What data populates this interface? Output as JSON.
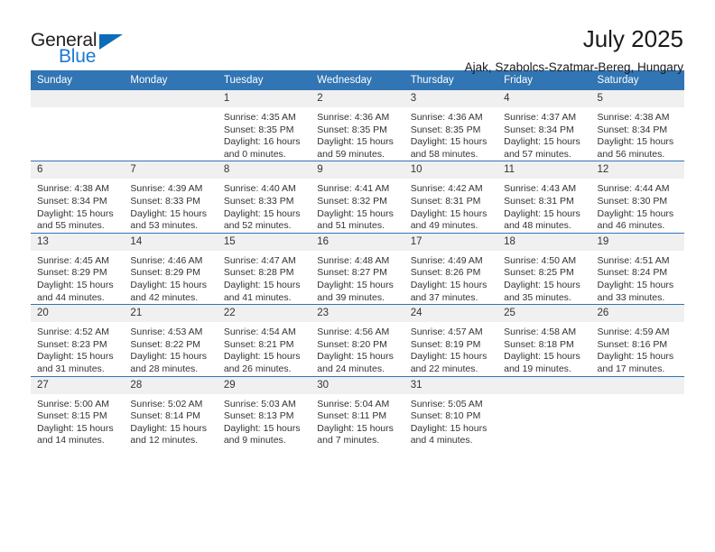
{
  "brand": {
    "name_top": "General",
    "name_bottom": "Blue",
    "triangle_color": "#0d6cb9",
    "blue_color": "#1b7ad1",
    "dark_color": "#231f20"
  },
  "header": {
    "title": "July 2025",
    "subtitle": "Ajak, Szabolcs-Szatmar-Bereg, Hungary"
  },
  "theme": {
    "header_blue": "#3175b4",
    "daynum_band": "#f0f0f0",
    "text": "#333333"
  },
  "weekday_headers": [
    "Sunday",
    "Monday",
    "Tuesday",
    "Wednesday",
    "Thursday",
    "Friday",
    "Saturday"
  ],
  "labels": {
    "sunrise_prefix": "Sunrise: ",
    "sunset_prefix": "Sunset: ",
    "daylight_prefix": "Daylight: "
  },
  "weeks": [
    [
      {
        "day": "",
        "empty": true
      },
      {
        "day": "",
        "empty": true
      },
      {
        "day": "1",
        "sunrise": "Sunrise: 4:35 AM",
        "sunset": "Sunset: 8:35 PM",
        "daylight": "Daylight: 16 hours and 0 minutes."
      },
      {
        "day": "2",
        "sunrise": "Sunrise: 4:36 AM",
        "sunset": "Sunset: 8:35 PM",
        "daylight": "Daylight: 15 hours and 59 minutes."
      },
      {
        "day": "3",
        "sunrise": "Sunrise: 4:36 AM",
        "sunset": "Sunset: 8:35 PM",
        "daylight": "Daylight: 15 hours and 58 minutes."
      },
      {
        "day": "4",
        "sunrise": "Sunrise: 4:37 AM",
        "sunset": "Sunset: 8:34 PM",
        "daylight": "Daylight: 15 hours and 57 minutes."
      },
      {
        "day": "5",
        "sunrise": "Sunrise: 4:38 AM",
        "sunset": "Sunset: 8:34 PM",
        "daylight": "Daylight: 15 hours and 56 minutes."
      }
    ],
    [
      {
        "day": "6",
        "sunrise": "Sunrise: 4:38 AM",
        "sunset": "Sunset: 8:34 PM",
        "daylight": "Daylight: 15 hours and 55 minutes."
      },
      {
        "day": "7",
        "sunrise": "Sunrise: 4:39 AM",
        "sunset": "Sunset: 8:33 PM",
        "daylight": "Daylight: 15 hours and 53 minutes."
      },
      {
        "day": "8",
        "sunrise": "Sunrise: 4:40 AM",
        "sunset": "Sunset: 8:33 PM",
        "daylight": "Daylight: 15 hours and 52 minutes."
      },
      {
        "day": "9",
        "sunrise": "Sunrise: 4:41 AM",
        "sunset": "Sunset: 8:32 PM",
        "daylight": "Daylight: 15 hours and 51 minutes."
      },
      {
        "day": "10",
        "sunrise": "Sunrise: 4:42 AM",
        "sunset": "Sunset: 8:31 PM",
        "daylight": "Daylight: 15 hours and 49 minutes."
      },
      {
        "day": "11",
        "sunrise": "Sunrise: 4:43 AM",
        "sunset": "Sunset: 8:31 PM",
        "daylight": "Daylight: 15 hours and 48 minutes."
      },
      {
        "day": "12",
        "sunrise": "Sunrise: 4:44 AM",
        "sunset": "Sunset: 8:30 PM",
        "daylight": "Daylight: 15 hours and 46 minutes."
      }
    ],
    [
      {
        "day": "13",
        "sunrise": "Sunrise: 4:45 AM",
        "sunset": "Sunset: 8:29 PM",
        "daylight": "Daylight: 15 hours and 44 minutes."
      },
      {
        "day": "14",
        "sunrise": "Sunrise: 4:46 AM",
        "sunset": "Sunset: 8:29 PM",
        "daylight": "Daylight: 15 hours and 42 minutes."
      },
      {
        "day": "15",
        "sunrise": "Sunrise: 4:47 AM",
        "sunset": "Sunset: 8:28 PM",
        "daylight": "Daylight: 15 hours and 41 minutes."
      },
      {
        "day": "16",
        "sunrise": "Sunrise: 4:48 AM",
        "sunset": "Sunset: 8:27 PM",
        "daylight": "Daylight: 15 hours and 39 minutes."
      },
      {
        "day": "17",
        "sunrise": "Sunrise: 4:49 AM",
        "sunset": "Sunset: 8:26 PM",
        "daylight": "Daylight: 15 hours and 37 minutes."
      },
      {
        "day": "18",
        "sunrise": "Sunrise: 4:50 AM",
        "sunset": "Sunset: 8:25 PM",
        "daylight": "Daylight: 15 hours and 35 minutes."
      },
      {
        "day": "19",
        "sunrise": "Sunrise: 4:51 AM",
        "sunset": "Sunset: 8:24 PM",
        "daylight": "Daylight: 15 hours and 33 minutes."
      }
    ],
    [
      {
        "day": "20",
        "sunrise": "Sunrise: 4:52 AM",
        "sunset": "Sunset: 8:23 PM",
        "daylight": "Daylight: 15 hours and 31 minutes."
      },
      {
        "day": "21",
        "sunrise": "Sunrise: 4:53 AM",
        "sunset": "Sunset: 8:22 PM",
        "daylight": "Daylight: 15 hours and 28 minutes."
      },
      {
        "day": "22",
        "sunrise": "Sunrise: 4:54 AM",
        "sunset": "Sunset: 8:21 PM",
        "daylight": "Daylight: 15 hours and 26 minutes."
      },
      {
        "day": "23",
        "sunrise": "Sunrise: 4:56 AM",
        "sunset": "Sunset: 8:20 PM",
        "daylight": "Daylight: 15 hours and 24 minutes."
      },
      {
        "day": "24",
        "sunrise": "Sunrise: 4:57 AM",
        "sunset": "Sunset: 8:19 PM",
        "daylight": "Daylight: 15 hours and 22 minutes."
      },
      {
        "day": "25",
        "sunrise": "Sunrise: 4:58 AM",
        "sunset": "Sunset: 8:18 PM",
        "daylight": "Daylight: 15 hours and 19 minutes."
      },
      {
        "day": "26",
        "sunrise": "Sunrise: 4:59 AM",
        "sunset": "Sunset: 8:16 PM",
        "daylight": "Daylight: 15 hours and 17 minutes."
      }
    ],
    [
      {
        "day": "27",
        "sunrise": "Sunrise: 5:00 AM",
        "sunset": "Sunset: 8:15 PM",
        "daylight": "Daylight: 15 hours and 14 minutes."
      },
      {
        "day": "28",
        "sunrise": "Sunrise: 5:02 AM",
        "sunset": "Sunset: 8:14 PM",
        "daylight": "Daylight: 15 hours and 12 minutes."
      },
      {
        "day": "29",
        "sunrise": "Sunrise: 5:03 AM",
        "sunset": "Sunset: 8:13 PM",
        "daylight": "Daylight: 15 hours and 9 minutes."
      },
      {
        "day": "30",
        "sunrise": "Sunrise: 5:04 AM",
        "sunset": "Sunset: 8:11 PM",
        "daylight": "Daylight: 15 hours and 7 minutes."
      },
      {
        "day": "31",
        "sunrise": "Sunrise: 5:05 AM",
        "sunset": "Sunset: 8:10 PM",
        "daylight": "Daylight: 15 hours and 4 minutes."
      },
      {
        "day": "",
        "empty": true
      },
      {
        "day": "",
        "empty": true
      }
    ]
  ]
}
